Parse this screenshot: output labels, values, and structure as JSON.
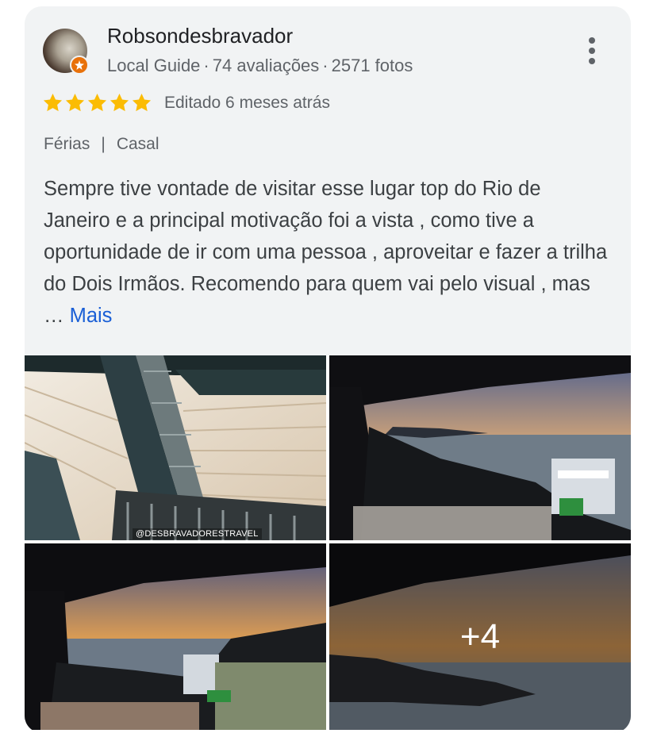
{
  "review": {
    "author_name": "Robsondesbravador",
    "author_level": "Local Guide",
    "reviews_count": "74 avaliações",
    "photos_count": "2571 fotos",
    "rating": 5,
    "edited": "Editado 6 meses atrás",
    "tags": [
      "Férias",
      "Casal"
    ],
    "text": "Sempre tive vontade de visitar esse lugar top do Rio de Janeiro e a principal motivação foi a vista , como tive a oportunidade de ir com uma pessoa , aproveitar e fazer a trilha do Dois Irmãos. Recomendo para quem vai pelo visual , mas … ",
    "more_label": "Mais"
  },
  "photos": {
    "watermark": "@DESBRAVADORESTRAVEL",
    "extra_count": "+4"
  },
  "icons": {
    "menu": "more-vert-icon",
    "star": "star-icon",
    "badge": "local-guide-badge-icon"
  },
  "colors": {
    "star": "#fbbc04",
    "link": "#1a5fd6",
    "badge": "#e8710a"
  }
}
